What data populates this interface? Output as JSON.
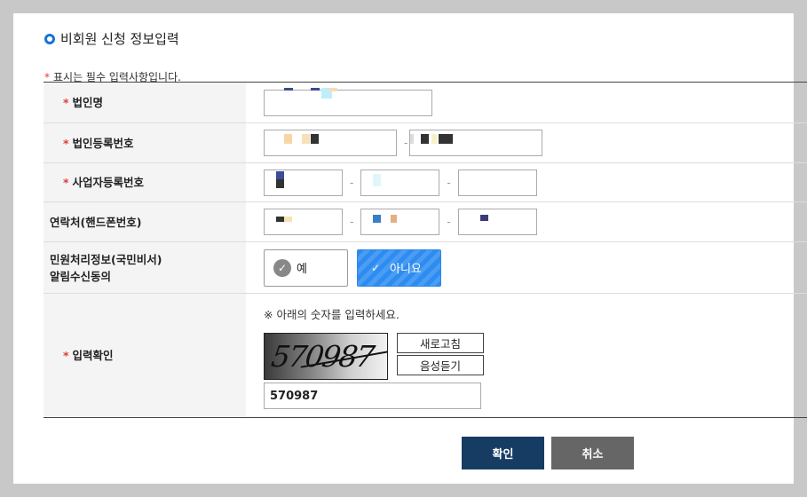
{
  "section_title": "비회원 신청 정보입력",
  "required_note": "표시는 필수 입력사항입니다.",
  "required_mark": "*",
  "fields": {
    "corp_name": {
      "label": "법인명"
    },
    "corp_reg_no": {
      "label": "법인등록번호",
      "separator": "-"
    },
    "biz_reg_no": {
      "label": "사업자등록번호",
      "separator": "-"
    },
    "phone": {
      "label": "연락처(핸드폰번호)",
      "separator": "-"
    },
    "consent": {
      "label_line1": "민원처리정보(국민비서)",
      "label_line2": "알림수신동의",
      "options": [
        "예",
        "아니요"
      ],
      "selected": "아니요"
    },
    "captcha": {
      "label": "입력확인",
      "note": "※ 아래의 숫자를 입력하세요.",
      "image_text": "570987",
      "refresh_label": "새로고침",
      "audio_label": "음성듣기",
      "value": "570987"
    }
  },
  "buttons": {
    "confirm": "확인",
    "cancel": "취소"
  },
  "colors": {
    "accent": "#2d8cf0",
    "required": "#e23b3b",
    "confirm_bg": "#163c64",
    "cancel_bg": "#666666"
  }
}
